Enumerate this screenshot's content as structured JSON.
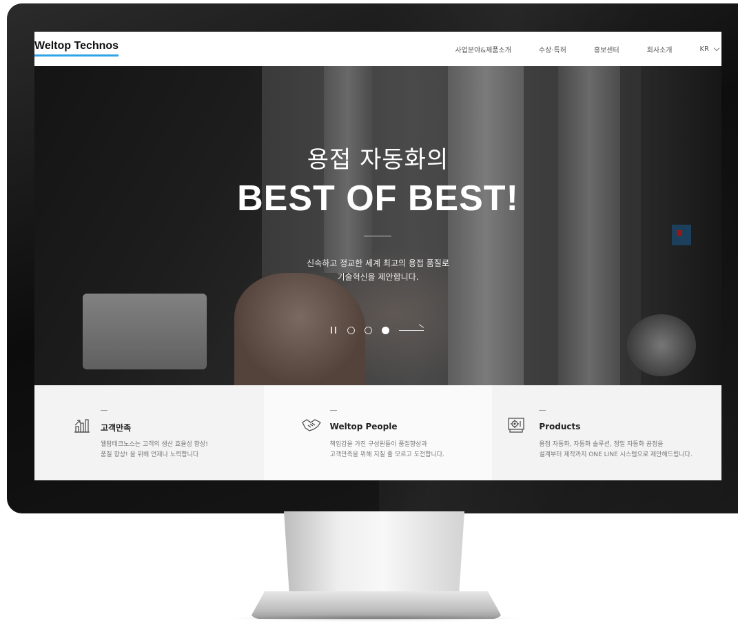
{
  "header": {
    "logo": "Weltop Technos",
    "nav": [
      "사업분야&제품소개",
      "수상·특허",
      "홍보센터",
      "회사소개"
    ],
    "lang": "KR"
  },
  "hero": {
    "subtitle": "용접 자동화의",
    "title": "BEST OF BEST!",
    "desc_line1": "신속하고 정교한 세계 최고의 용접 품질로",
    "desc_line2": "기술혁신을 제안합니다.",
    "slides": 3,
    "active_slide": 3
  },
  "features": [
    {
      "title": "고객만족",
      "line1": "웰탑테크노스는 고객의 생산 효율성 향상!",
      "line2": "품질 향상! 을 위해 언제나 노력합니다",
      "icon": "growth-chart-icon"
    },
    {
      "title": "Weltop People",
      "line1": "책임감을 가진 구성원들이 품질향상과",
      "line2": "고객만족을 위해 지칠 줄 모르고 도전합니다.",
      "icon": "handshake-icon"
    },
    {
      "title": "Products",
      "line1": "용접 자동화, 자동화 솔루션, 정밀 자동화 공정을",
      "line2": "설계부터 제작까지 ONE LINE 시스템으로 제안해드립니다.",
      "icon": "machine-gear-icon"
    }
  ],
  "colors": {
    "accent": "#2ea3e6",
    "feature_bg": "#f3f3f3"
  }
}
